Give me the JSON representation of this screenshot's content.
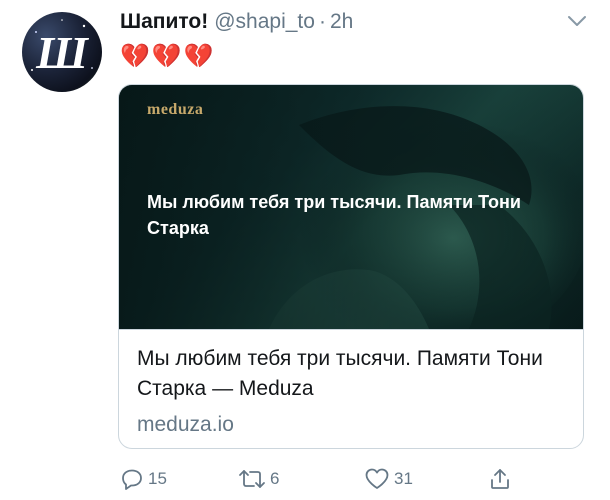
{
  "tweet": {
    "display_name": "Шапито!",
    "handle": "@shapi_to",
    "separator": "·",
    "time": "2h",
    "text": "💔💔💔",
    "avatar_icon": "shapito-logo-icon",
    "menu_icon": "chevron-down-icon"
  },
  "card": {
    "image": {
      "brand": "meduza",
      "headline": "Мы любим тебя три тысячи. Памяти Тони Старка"
    },
    "title": "Мы любим тебя три тысячи. Памяти Тони Старка — Meduza",
    "domain": "meduza.io"
  },
  "actions": {
    "reply": {
      "icon": "reply-icon",
      "count": "15"
    },
    "retweet": {
      "icon": "retweet-icon",
      "count": "6"
    },
    "like": {
      "icon": "heart-icon",
      "count": "31"
    },
    "share": {
      "icon": "share-icon"
    }
  },
  "colors": {
    "secondary_text": "#657786",
    "border": "#ccd6dd",
    "brand_gold": "#c7a96b"
  }
}
